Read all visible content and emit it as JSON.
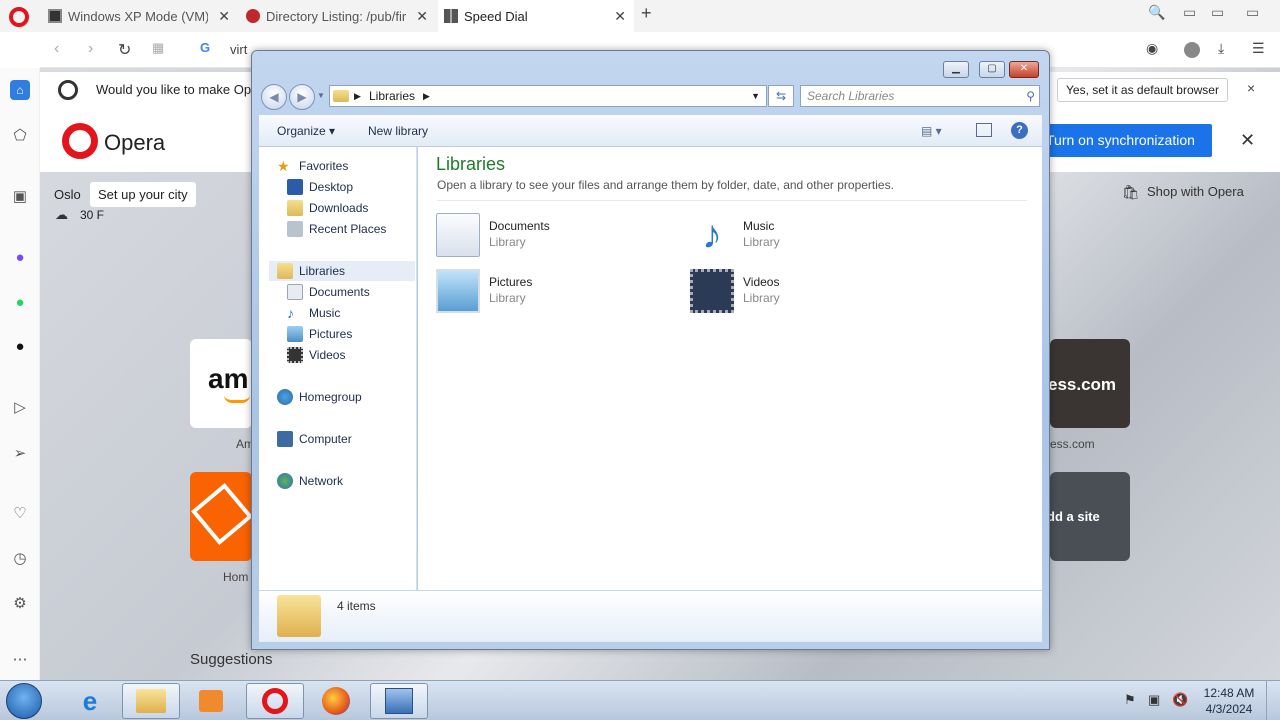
{
  "browser": {
    "tabs": [
      {
        "title": "Windows XP Mode (VM) : !"
      },
      {
        "title": "Directory Listing: /pub/firef"
      },
      {
        "title": "Speed Dial"
      }
    ],
    "new_tab_glyph": "+",
    "address_text": "virt",
    "notification": {
      "text": "Would you like to make Opera",
      "default_button": "Yes, set it as default browser",
      "close_glyph": "×"
    },
    "brand": "Opera",
    "sync_button": "Turn on synchronization",
    "weather": {
      "city": "Oslo",
      "set_city": "Set up your city",
      "temp": "30 F"
    },
    "shop": "Shop with Opera",
    "tiles": [
      {
        "label": "Am",
        "logo": "amazon"
      },
      {
        "label": "ess.com",
        "logo": "ess.com"
      },
      {
        "label": "Hom",
        "logo": "home-depot"
      },
      {
        "label": "",
        "logo": "add-site",
        "text": "dd a site"
      }
    ],
    "suggestions": "Suggestions"
  },
  "explorer": {
    "path": "Libraries",
    "search_placeholder": "Search Libraries",
    "commands": {
      "organize": "Organize",
      "new_library": "New library"
    },
    "nav": {
      "favorites": "Favorites",
      "favorites_items": [
        "Desktop",
        "Downloads",
        "Recent Places"
      ],
      "libraries": "Libraries",
      "libraries_items": [
        "Documents",
        "Music",
        "Pictures",
        "Videos"
      ],
      "homegroup": "Homegroup",
      "computer": "Computer",
      "network": "Network"
    },
    "content": {
      "title": "Libraries",
      "subtitle": "Open a library to see your files and arrange them by folder, date, and other properties.",
      "items": [
        {
          "name": "Documents",
          "type": "Library"
        },
        {
          "name": "Music",
          "type": "Library"
        },
        {
          "name": "Pictures",
          "type": "Library"
        },
        {
          "name": "Videos",
          "type": "Library"
        }
      ]
    },
    "details": {
      "count": "4 items"
    }
  },
  "taskbar": {
    "time": "12:48 AM",
    "date": "4/3/2024"
  },
  "colors": {
    "opera_red": "#e4141b",
    "sync_blue": "#1a73e8",
    "explorer_title_green": "#1f7a2b"
  }
}
